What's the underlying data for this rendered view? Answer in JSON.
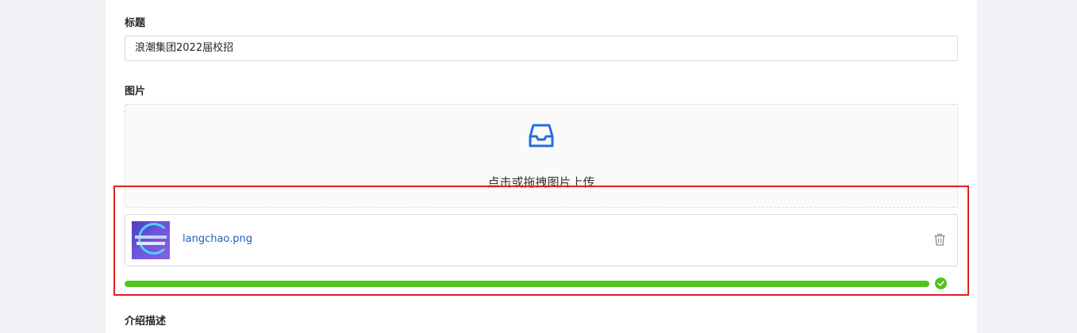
{
  "form": {
    "title_label": "标题",
    "title_value": "浪潮集团2022届校招",
    "image_label": "图片",
    "upload_hint": "点击或拖拽图片上传",
    "file_name": "langchao.png",
    "upload_progress_percent": 100,
    "description_label": "介绍描述"
  },
  "icons": {
    "dropzone": "inbox-icon",
    "delete": "trash-icon",
    "status": "check-circle-icon"
  },
  "colors": {
    "accent": "#1f5fbf",
    "progress": "#52c41a",
    "highlight": "#e02020"
  }
}
